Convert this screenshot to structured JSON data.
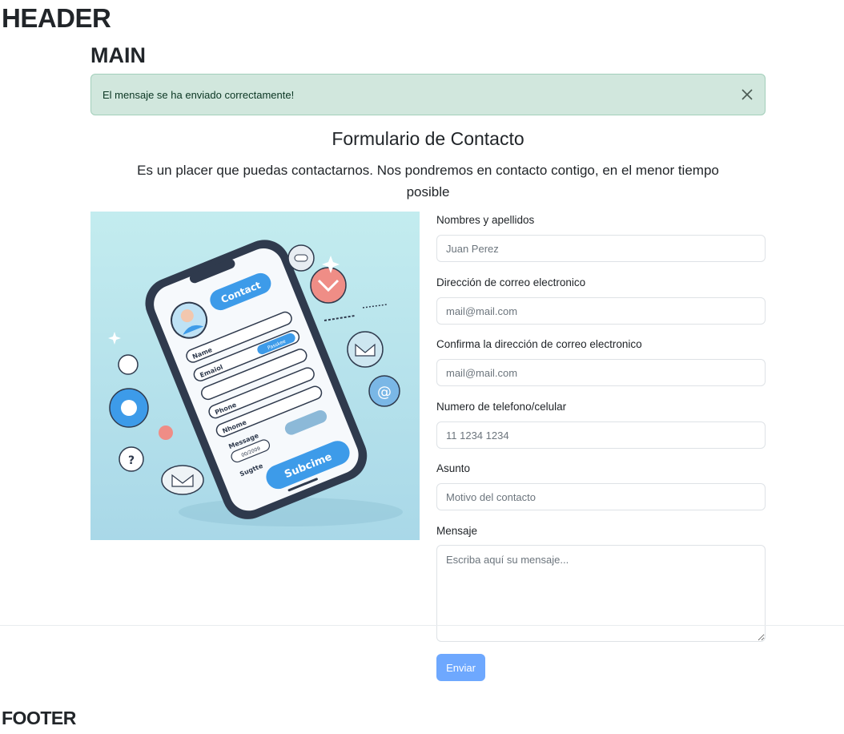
{
  "header": {
    "title": "HEADER"
  },
  "main": {
    "title": "MAIN"
  },
  "alert": {
    "message": "El mensaje se ha enviado correctamente!"
  },
  "form": {
    "title": "Formulario de Contacto",
    "subtitle": "Es un placer que puedas contactarnos. Nos pondremos en contacto contigo, en el menor tiempo posible",
    "fields": {
      "name": {
        "label": "Nombres y apellidos",
        "placeholder": "Juan Perez"
      },
      "email": {
        "label": "Dirección de correo electronico",
        "placeholder": "mail@mail.com"
      },
      "email_confirm": {
        "label": "Confirma la dirección de correo electronico",
        "placeholder": "mail@mail.com"
      },
      "phone": {
        "label": "Numero de telefono/celular",
        "placeholder": "11 1234 1234"
      },
      "subject": {
        "label": "Asunto",
        "placeholder": "Motivo del contacto"
      },
      "message": {
        "label": "Mensaje",
        "placeholder": "Escriba aquí su mensaje..."
      }
    },
    "submit_label": "Enviar"
  },
  "illustration": {
    "contact_label": "Contact",
    "field_labels": [
      "Name",
      "Emaiol",
      "Phone",
      "Nhome",
      "Message",
      "Sugtte"
    ],
    "chip_label": "Passkee",
    "date_value": "00/2009",
    "submit_label": "Subcime"
  },
  "footer": {
    "title": "FOOTER"
  },
  "colors": {
    "alert_bg": "#d1e7dd",
    "alert_text": "#0a3622",
    "button_bg": "#6ea8fe",
    "illustration_bg": "#bfe6ec",
    "accent_blue": "#3d9be9"
  }
}
